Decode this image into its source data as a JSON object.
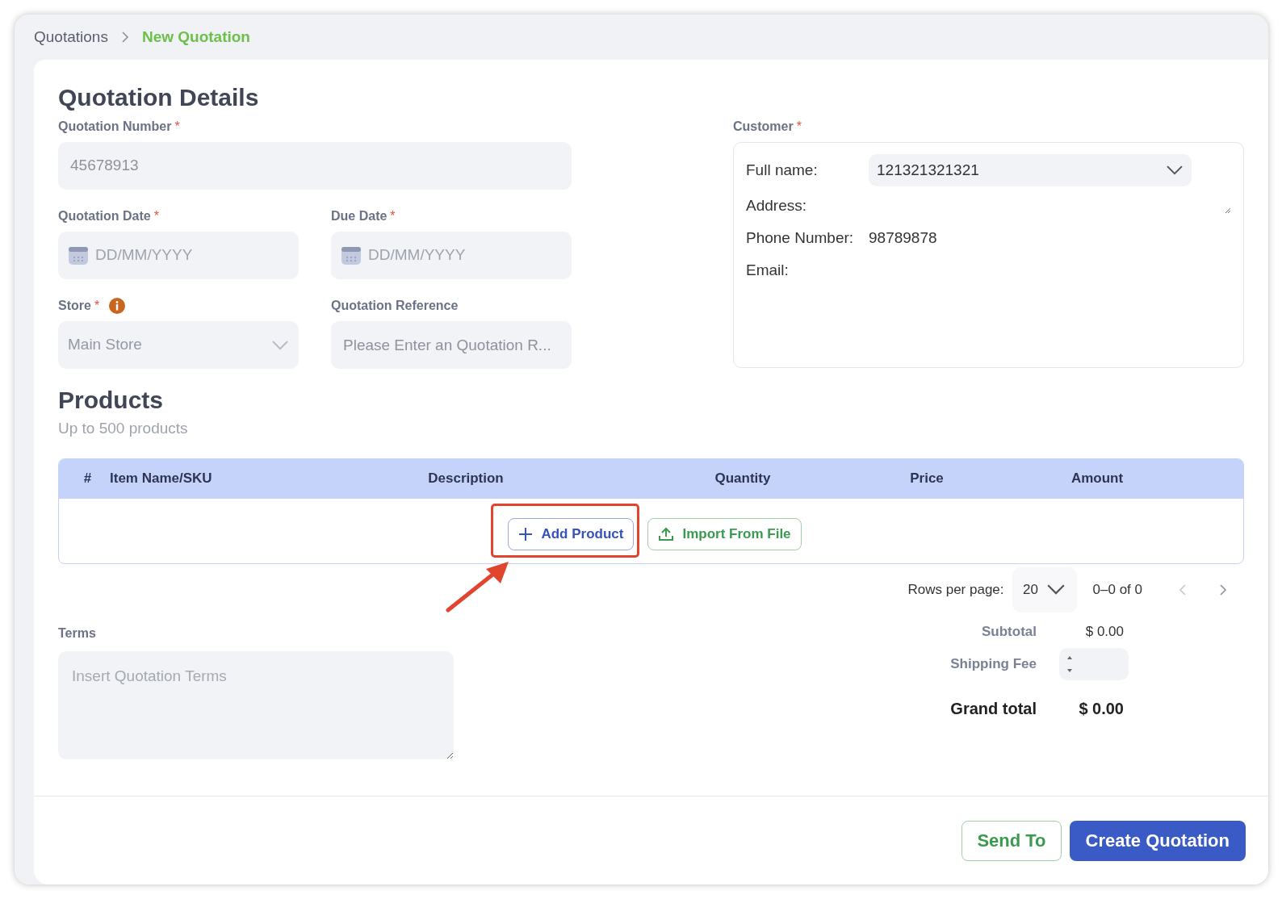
{
  "breadcrumb": [
    {
      "label": "Quotations",
      "selected": false
    },
    {
      "label": "New Quotation",
      "selected": true
    }
  ],
  "details": {
    "title": "Quotation Details",
    "quotation_number": {
      "label": "Quotation Number",
      "required_mark": "*",
      "value": "45678913",
      "disabled": true
    },
    "quotation_date": {
      "label": "Quotation Date",
      "required_mark": "*",
      "placeholder": "DD/MM/YYYY"
    },
    "due_date": {
      "label": "Due Date",
      "required_mark": "*",
      "placeholder": "DD/MM/YYYY"
    },
    "store": {
      "label": "Store",
      "required_mark": "*",
      "value": "Main Store",
      "disabled": true
    },
    "quotation_reference": {
      "label": "Quotation Reference",
      "placeholder": "Please Enter an Quotation R..."
    }
  },
  "customer": {
    "label": "Customer",
    "required_mark": "*",
    "full_name_label": "Full name:",
    "full_name_value": "121321321321",
    "address_label": "Address:",
    "phone_label": "Phone Number:",
    "phone_value": "98789878",
    "email_label": "Email:"
  },
  "products": {
    "title": "Products",
    "subtitle": "Up to 500 products",
    "columns": [
      "#",
      "Item Name/SKU",
      "Description",
      "Quantity",
      "Price",
      "Amount"
    ],
    "add_button": "Add Product",
    "import_button": "Import From File"
  },
  "pagination": {
    "rows_label": "Rows per page:",
    "rows_value": "20",
    "range": "0–0 of 0"
  },
  "terms": {
    "label": "Terms",
    "placeholder": "Insert Quotation Terms"
  },
  "totals": {
    "subtotal_label": "Subtotal",
    "subtotal_value": "$ 0.00",
    "shipping_label": "Shipping Fee",
    "grand_label": "Grand total",
    "grand_value": "$ 0.00"
  },
  "actions": {
    "send": "Send To",
    "create": "Create Quotation"
  }
}
